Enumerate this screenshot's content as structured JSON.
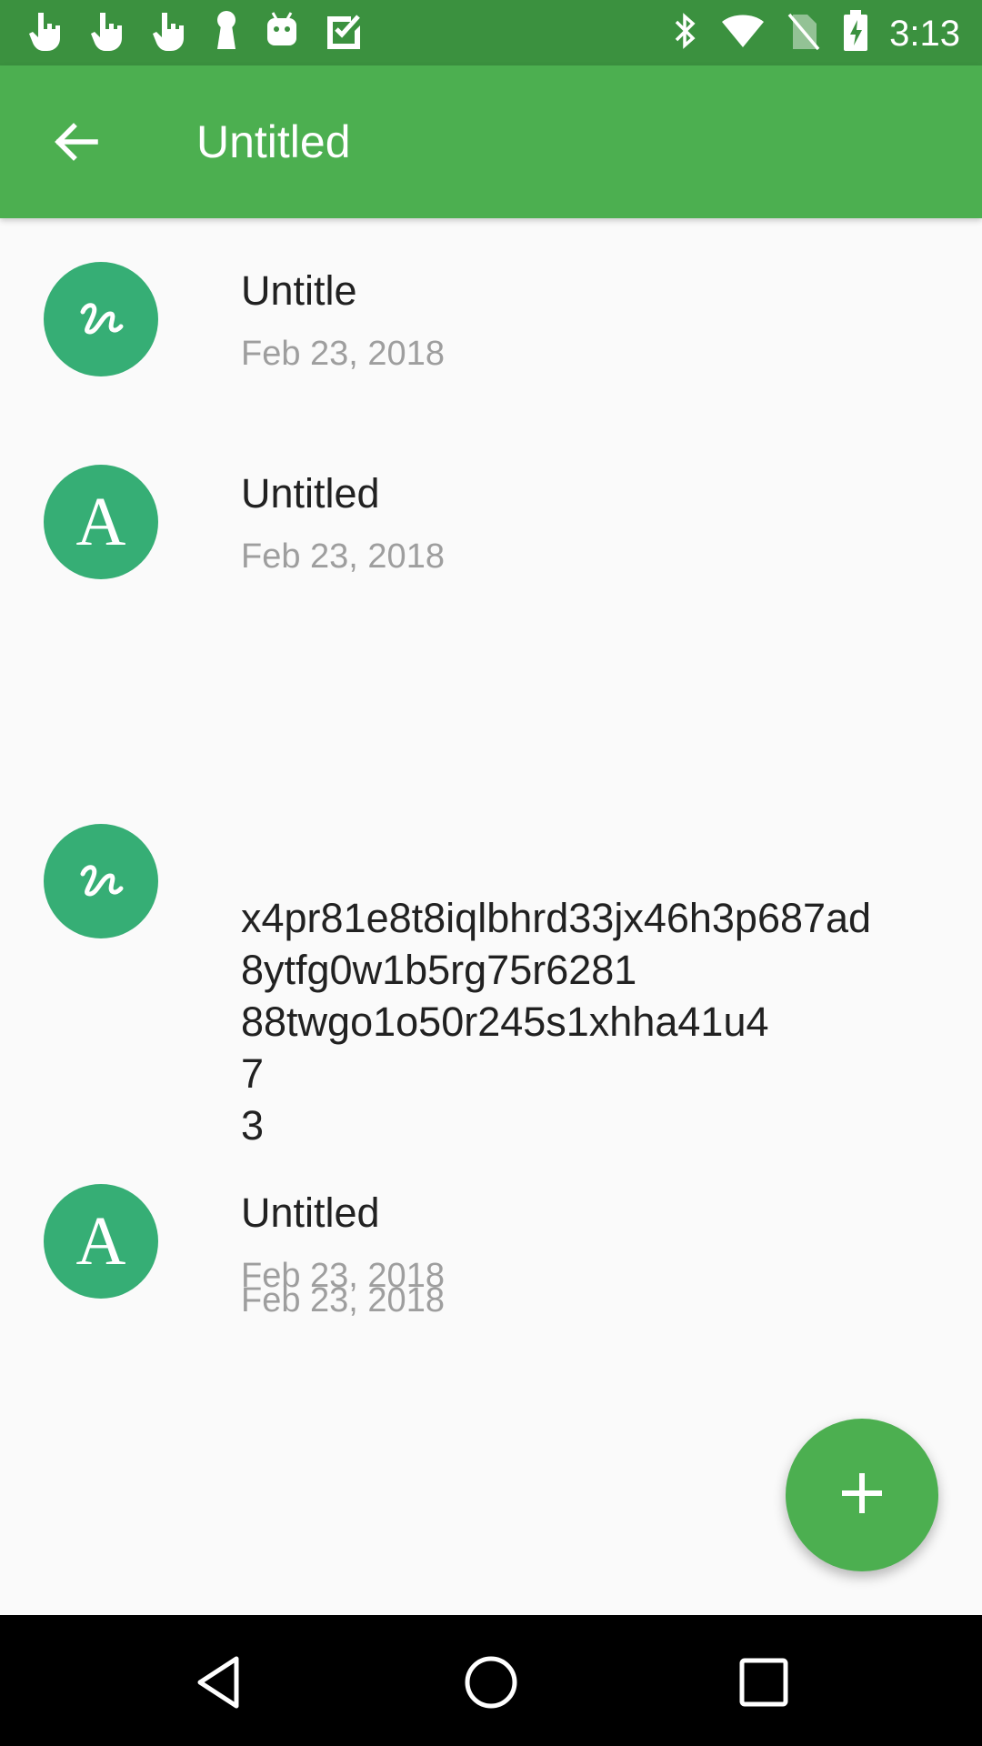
{
  "status_bar": {
    "time": "3:13",
    "left_icons": [
      "hand-pointer-icon",
      "hand-pointer-icon",
      "hand-pointer-icon",
      "keyhole-icon",
      "android-icon",
      "checkbox-icon"
    ],
    "right_icons": [
      "bluetooth-icon",
      "wifi-icon",
      "no-sim-icon",
      "battery-charging-icon"
    ]
  },
  "app_bar": {
    "title": "Untitled",
    "back_icon": "arrow-back-icon",
    "color": "#4caf50"
  },
  "list": {
    "items": [
      {
        "type": "drawing",
        "icon": "squiggle-icon",
        "title": "Untitle",
        "date": "Feb 23, 2018"
      },
      {
        "type": "text",
        "icon": "letter-a-icon",
        "avatar_letter": "A",
        "title": "Untitled",
        "date": "Feb 23, 2018"
      },
      {
        "type": "drawing",
        "icon": "squiggle-icon",
        "title": "x4pr81e8t8iqlbhrd33jx46h3p687ad\n8ytfg0w1b5rg75r6281\n88twgo1o50r245s1xhha41u4\n7\n3",
        "date": "Feb 23, 2018"
      },
      {
        "type": "text",
        "icon": "letter-a-icon",
        "avatar_letter": "A",
        "title": "Untitled",
        "date": "Feb 23, 2018"
      }
    ],
    "avatar_color": "#36ae75"
  },
  "fab": {
    "icon": "plus-icon"
  },
  "nav_bar": {
    "icons": [
      "nav-back-icon",
      "nav-home-icon",
      "nav-recents-icon"
    ]
  }
}
